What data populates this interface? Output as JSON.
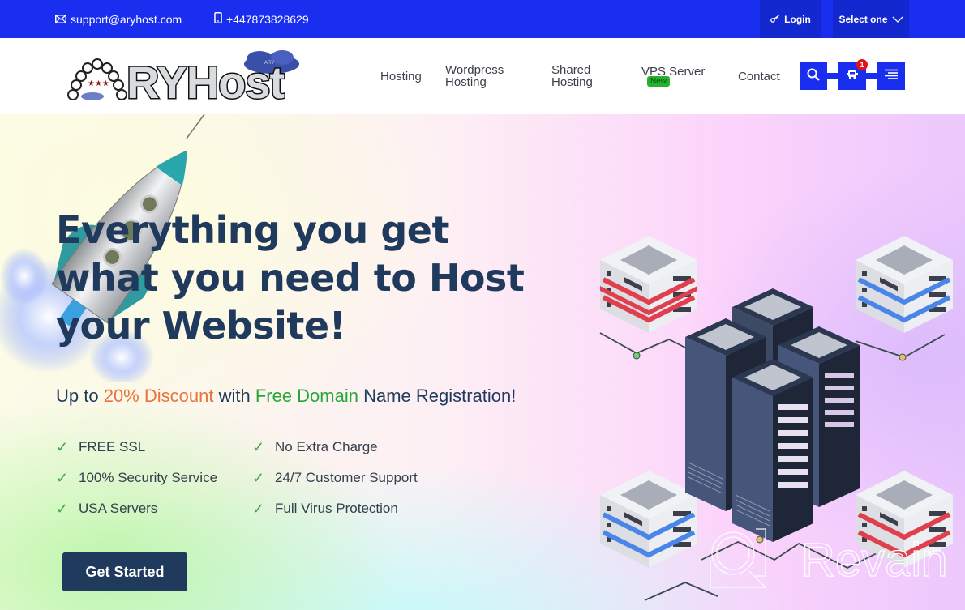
{
  "topbar": {
    "email": "support@aryhost.com",
    "phone": "+447873828629",
    "login_label": "Login",
    "select_label": "Select one"
  },
  "brand": {
    "name": "ARYHost",
    "cloud_text": "ARY"
  },
  "nav": {
    "items": [
      {
        "label_line1": "Hosting",
        "label_line2": ""
      },
      {
        "label_line1": "Wordpress",
        "label_line2": "Hosting"
      },
      {
        "label_line1": "Shared",
        "label_line2": "Hosting"
      },
      {
        "label_line1": "VPS Server",
        "label_line2": ""
      },
      {
        "label_line1": "Contact",
        "label_line2": ""
      }
    ],
    "vps_badge": "New",
    "cart_count": "1",
    "icons": {
      "search": "search-icon",
      "cart": "cart-icon",
      "menu": "menu-icon"
    }
  },
  "hero": {
    "headline": "Everything you get what you need to Host your Website!",
    "sub_prefix": "Up to ",
    "sub_discount": "20% Discount",
    "sub_mid": " with ",
    "sub_domain": "Free Domain",
    "sub_suffix": " Name Registration!",
    "check_glyph": "✓",
    "features": [
      "FREE SSL",
      "No Extra Charge",
      "100% Security Service",
      "24/7 Customer Support",
      "USA Servers",
      "Full Virus Protection"
    ],
    "cta_label": "Get Started"
  },
  "colors": {
    "topbar": "#1a2ef0",
    "accent_orange": "#e8743f",
    "accent_green": "#27a73a",
    "heading": "#1f3a5c",
    "new_badge": "#22b22c",
    "cart_badge": "#e3131e"
  },
  "watermark": {
    "text": "Revain"
  }
}
